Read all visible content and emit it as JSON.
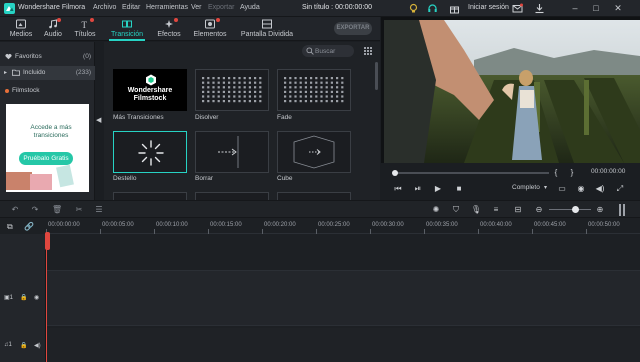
{
  "window": {
    "app_name": "Wondershare Filmora",
    "project_title": "Sin título : 00:00:00:00",
    "login_label": "Iniciar sesión"
  },
  "menu": [
    "Archivo",
    "Editar",
    "Herramientas",
    "Ver",
    "Exportar",
    "Ayuda"
  ],
  "tabs": [
    {
      "label": "Medios",
      "icon": "media-icon"
    },
    {
      "label": "Audio",
      "icon": "music-note-icon"
    },
    {
      "label": "Títulos",
      "icon": "titles-icon"
    },
    {
      "label": "Transición",
      "icon": "transition-icon",
      "active": true
    },
    {
      "label": "Efectos",
      "icon": "effects-icon"
    },
    {
      "label": "Elementos",
      "icon": "elements-icon"
    },
    {
      "label": "Pantalla Dividida",
      "icon": "split-screen-icon"
    }
  ],
  "export_label": "EXPORTAR",
  "left_panel": {
    "favorites": {
      "label": "Favoritos",
      "count": "(0)"
    },
    "included": {
      "label": "Incluido",
      "count": "(233)"
    },
    "filmstock": {
      "label": "Filmstock"
    },
    "ad": {
      "title": "Accede a más transiciones",
      "button": "Pruébalo Gratis"
    }
  },
  "library": {
    "search_placeholder": "Buscar",
    "items": [
      {
        "label": "Más Transiciones",
        "kind": "filmstock",
        "brand": "Wondershare Filmstock"
      },
      {
        "label": "Disolver",
        "kind": "dots"
      },
      {
        "label": "Fade",
        "kind": "dots"
      },
      {
        "label": "Destello",
        "kind": "flash",
        "selected": true
      },
      {
        "label": "Borrar",
        "kind": "wipe"
      },
      {
        "label": "Cube",
        "kind": "cube"
      }
    ]
  },
  "preview": {
    "timecode": "00:00:00:00",
    "quality": "Completo",
    "bracket_open": "{",
    "bracket_close": "}"
  },
  "timeline": {
    "ruler_labels": [
      "00:00:00:00",
      "00:00:05:00",
      "00:00:10:00",
      "00:00:15:00",
      "00:00:20:00",
      "00:00:25:00",
      "00:00:30:00",
      "00:00:35:00",
      "00:00:40:00",
      "00:00:45:00",
      "00:00:50:00"
    ]
  },
  "colors": {
    "accent": "#27d3c4",
    "playhead": "#e0473f",
    "notification_dot": "#e0473f"
  }
}
